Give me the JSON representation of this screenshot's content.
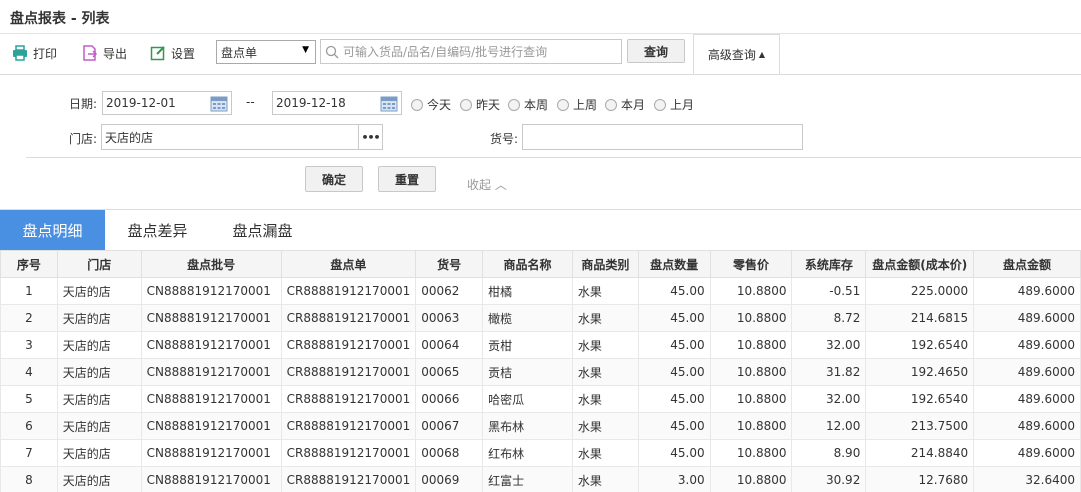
{
  "page_title": "盘点报表 - 列表",
  "toolbar": {
    "print_label": "打印",
    "export_label": "导出",
    "settings_label": "设置",
    "doc_type_value": "盘点单",
    "search_placeholder": "可输入货品/品名/自编码/批号进行查询",
    "query_label": "查询",
    "advanced_label": "高级查询",
    "advanced_caret": "▲"
  },
  "filter": {
    "date_label": "日期:",
    "date_start": "2019-12-01",
    "date_sep": "--",
    "date_end": "2019-12-18",
    "quick_dates": [
      "今天",
      "昨天",
      "本周",
      "上周",
      "本月",
      "上月"
    ],
    "store_label": "门店:",
    "store_value": "天店的店",
    "store_more": "•••",
    "sku_label": "货号:",
    "confirm_label": "确定",
    "reset_label": "重置",
    "collapse_label": "收起 ︿"
  },
  "tabs": [
    "盘点明细",
    "盘点差异",
    "盘点漏盘"
  ],
  "table": {
    "columns": [
      "序号",
      "门店",
      "盘点批号",
      "盘点单",
      "货号",
      "商品名称",
      "商品类别",
      "盘点数量",
      "零售价",
      "系统库存",
      "盘点金额(成本价)",
      "盘点金额"
    ],
    "rows": [
      [
        "1",
        "天店的店",
        "CN88881912170001",
        "CR88881912170001",
        "00062",
        "柑橘",
        "水果",
        "45.00",
        "10.8800",
        "-0.51",
        "225.0000",
        "489.6000"
      ],
      [
        "2",
        "天店的店",
        "CN88881912170001",
        "CR88881912170001",
        "00063",
        "橄榄",
        "水果",
        "45.00",
        "10.8800",
        "8.72",
        "214.6815",
        "489.6000"
      ],
      [
        "3",
        "天店的店",
        "CN88881912170001",
        "CR88881912170001",
        "00064",
        "贡柑",
        "水果",
        "45.00",
        "10.8800",
        "32.00",
        "192.6540",
        "489.6000"
      ],
      [
        "4",
        "天店的店",
        "CN88881912170001",
        "CR88881912170001",
        "00065",
        "贡桔",
        "水果",
        "45.00",
        "10.8800",
        "31.82",
        "192.4650",
        "489.6000"
      ],
      [
        "5",
        "天店的店",
        "CN88881912170001",
        "CR88881912170001",
        "00066",
        "哈密瓜",
        "水果",
        "45.00",
        "10.8800",
        "32.00",
        "192.6540",
        "489.6000"
      ],
      [
        "6",
        "天店的店",
        "CN88881912170001",
        "CR88881912170001",
        "00067",
        "黑布林",
        "水果",
        "45.00",
        "10.8800",
        "12.00",
        "213.7500",
        "489.6000"
      ],
      [
        "7",
        "天店的店",
        "CN88881912170001",
        "CR88881912170001",
        "00068",
        "红布林",
        "水果",
        "45.00",
        "10.8800",
        "8.90",
        "214.8840",
        "489.6000"
      ],
      [
        "8",
        "天店的店",
        "CN88881912170001",
        "CR88881912170001",
        "00069",
        "红富士",
        "水果",
        "3.00",
        "10.8800",
        "30.92",
        "12.7680",
        "32.6400"
      ]
    ]
  },
  "colors": {
    "accent": "#4a90e2",
    "print_icon": "#2aa39a",
    "export_icon": "#c45cc7",
    "settings_icon": "#2e9a4a",
    "calendar_icon": "#7a9cc6"
  }
}
